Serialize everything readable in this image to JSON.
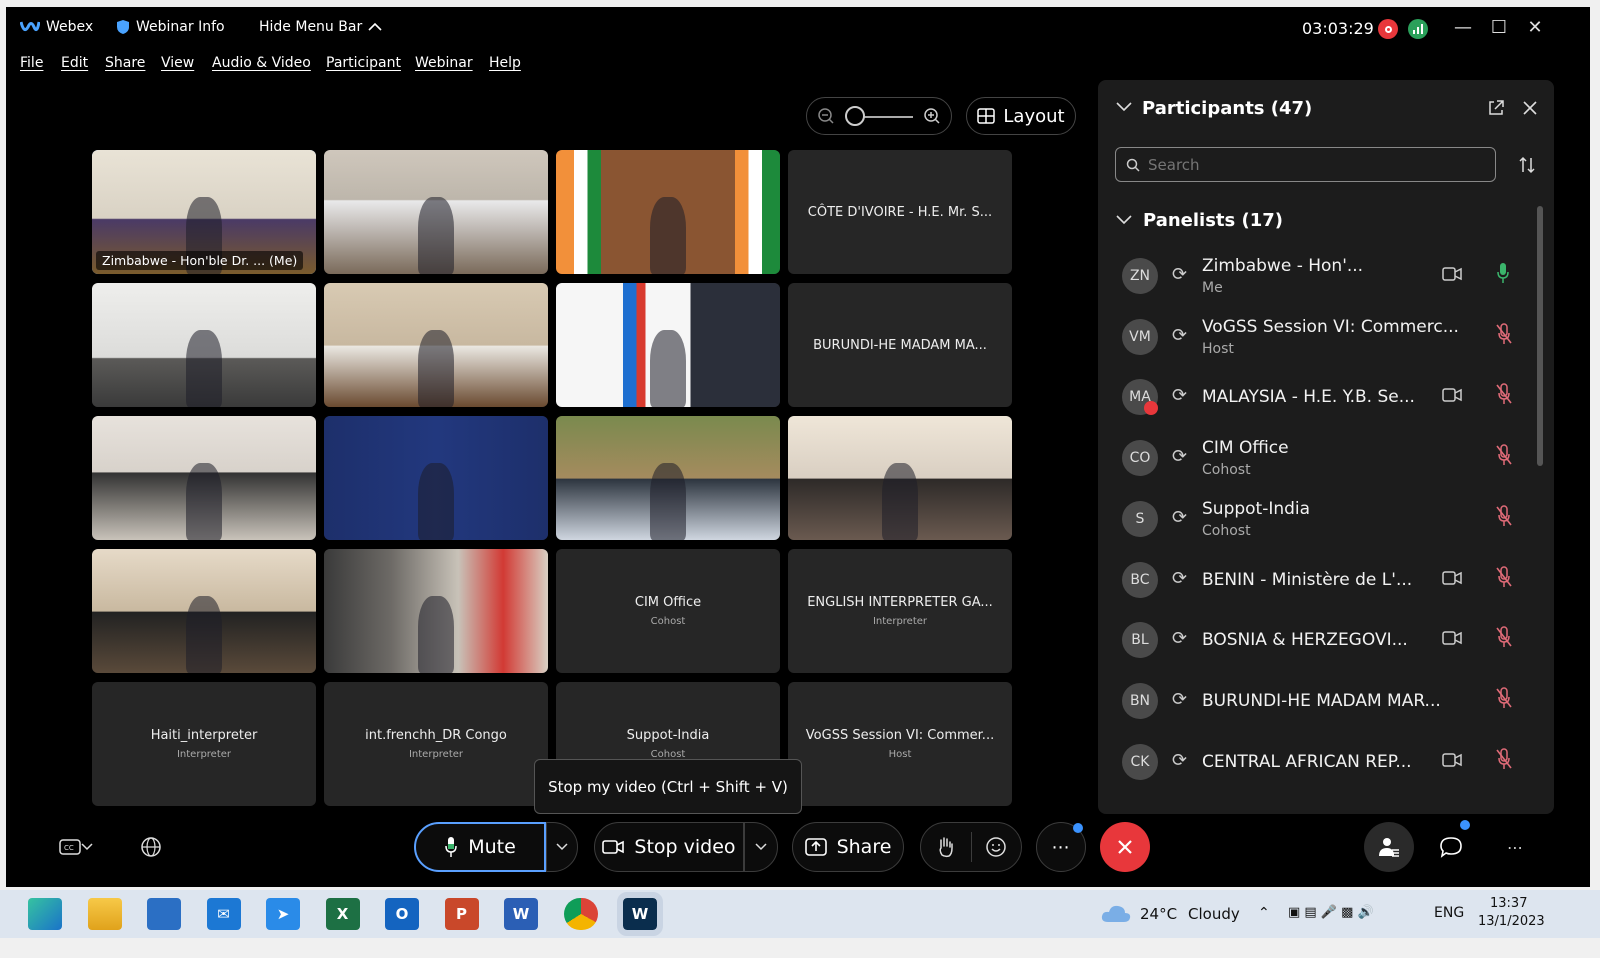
{
  "titlebar": {
    "app_name": "Webex",
    "webinar_info": "Webinar Info",
    "hide_menu": "Hide Menu Bar",
    "timer": "03:03:29"
  },
  "menu": [
    "File",
    "Edit",
    "Share",
    "View",
    "Audio & Video",
    "Participant",
    "Webinar",
    "Help"
  ],
  "layout_label": "Layout",
  "tiles": [
    {
      "type": "video",
      "label": "Zimbabwe - Hon'ble Dr. ... (Me)",
      "self": true
    },
    {
      "type": "video"
    },
    {
      "type": "video"
    },
    {
      "type": "name",
      "name": "CÔTE D'IVOIRE - H.E. Mr. S..."
    },
    {
      "type": "video"
    },
    {
      "type": "video"
    },
    {
      "type": "video"
    },
    {
      "type": "name",
      "name": "BURUNDI-HE MADAM MA..."
    },
    {
      "type": "video"
    },
    {
      "type": "video"
    },
    {
      "type": "video"
    },
    {
      "type": "video"
    },
    {
      "type": "video"
    },
    {
      "type": "video"
    },
    {
      "type": "name",
      "name": "CIM Office",
      "role": "Cohost"
    },
    {
      "type": "name",
      "name": "ENGLISH INTERPRETER GA...",
      "role": "Interpreter"
    },
    {
      "type": "name",
      "name": "Haiti_interpreter",
      "role": "Interpreter"
    },
    {
      "type": "name",
      "name": "int.frenchh_DR Congo",
      "role": "Interpreter"
    },
    {
      "type": "name",
      "name": "Suppot-India",
      "role": "Cohost"
    },
    {
      "type": "name",
      "name": "VoGSS Session VI: Commer...",
      "role": "Host"
    }
  ],
  "tooltip": "Stop my video (Ctrl + Shift + V)",
  "toolbar": {
    "mute": "Mute",
    "stop_video": "Stop video",
    "share": "Share"
  },
  "panel": {
    "title": "Participants (47)",
    "search_placeholder": "Search",
    "panelists_header": "Panelists (17)",
    "participants": [
      {
        "initials": "ZN",
        "name": "Zimbabwe - Hon'...",
        "role": "Me",
        "camera": true,
        "mic": "on"
      },
      {
        "initials": "VM",
        "name": "VoGSS Session VI: Commerc...",
        "role": "Host",
        "camera": false,
        "mic": "muted"
      },
      {
        "initials": "MA",
        "name": "MALAYSIA - H.E. Y.B. Se...",
        "role": "",
        "camera": true,
        "mic": "muted"
      },
      {
        "initials": "CO",
        "name": "CIM Office",
        "role": "Cohost",
        "camera": false,
        "mic": "muted"
      },
      {
        "initials": "S",
        "name": "Suppot-India",
        "role": "Cohost",
        "camera": false,
        "mic": "muted"
      },
      {
        "initials": "BC",
        "name": "BENIN - Ministère de L'...",
        "role": "",
        "camera": true,
        "mic": "muted"
      },
      {
        "initials": "BL",
        "name": "BOSNIA & HERZEGOVI...",
        "role": "",
        "camera": true,
        "mic": "muted"
      },
      {
        "initials": "BN",
        "name": "BURUNDI-HE MADAM MAR...",
        "role": "",
        "camera": false,
        "mic": "muted"
      },
      {
        "initials": "CK",
        "name": "CENTRAL AFRICAN REP...",
        "role": "",
        "camera": true,
        "mic": "muted"
      }
    ]
  },
  "taskbar": {
    "weather_temp": "24°C",
    "weather_desc": "Cloudy",
    "lang": "ENG",
    "time": "13:37",
    "date": "13/1/2023",
    "apps": [
      "edge-icon",
      "file-explorer-icon",
      "store-icon",
      "mail-icon",
      "safari-icon",
      "excel-icon",
      "outlook-icon",
      "powerpoint-icon",
      "word-icon",
      "chrome-icon",
      "webex-icon"
    ]
  },
  "colors": {
    "accent": "#5aa0ff",
    "end_call": "#e8373b",
    "muted_mic": "#e06b78",
    "active_mic": "#3bb56c"
  }
}
